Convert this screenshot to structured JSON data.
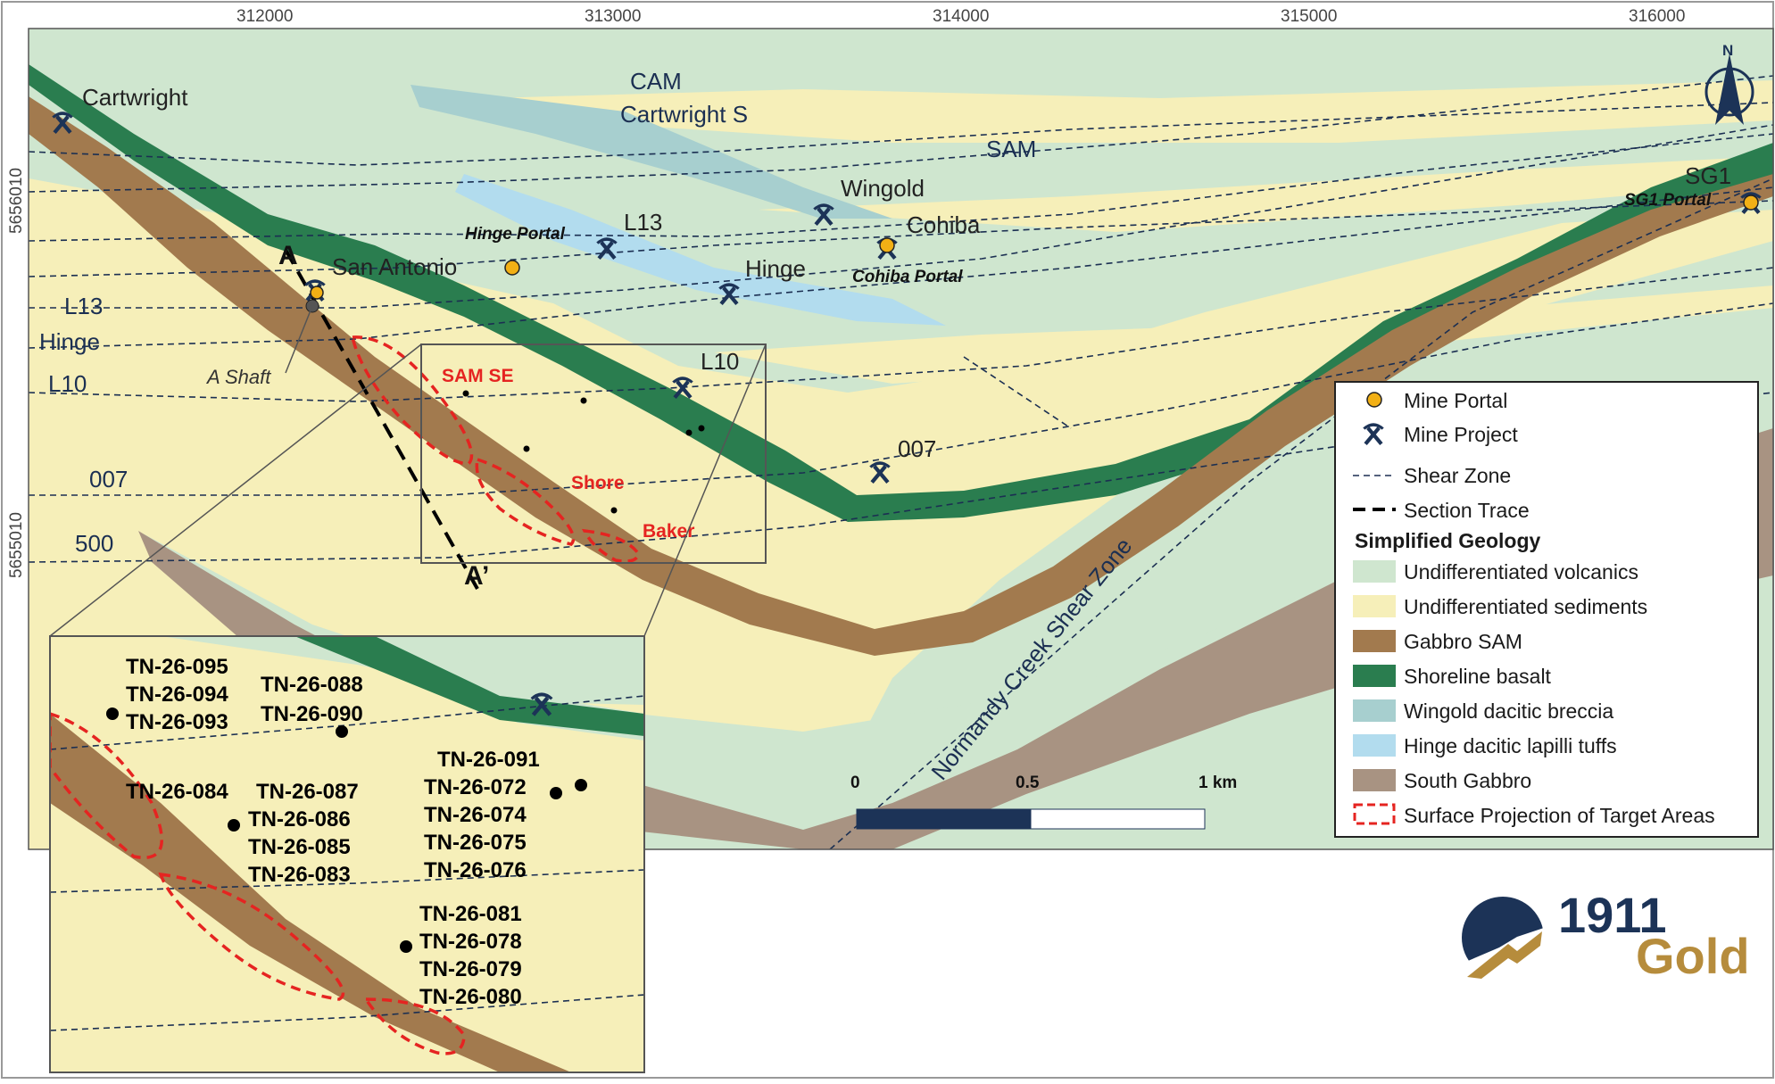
{
  "colors": {
    "sediments": "#f6efb9",
    "volcanics": "#cfe6cf",
    "gabbro_sam": "#a27a4e",
    "shoreline_basalt": "#2a7d4f",
    "wingold": "#a7cfcf",
    "hinge_tuffs": "#b2dcee",
    "south_gabbro": "#a89382",
    "target_outline": "#e52421",
    "shear": "#1b2f52",
    "portal": "#f2b015",
    "logo_navy": "#1c3357",
    "logo_gold": "#b68c3c"
  },
  "axes": {
    "eastings": [
      "312000",
      "313000",
      "314000",
      "315000",
      "316000"
    ],
    "northings": [
      "5656010",
      "5655010"
    ]
  },
  "north_arrow": "N",
  "shear_zones": [
    "CAM",
    "Cartwright S",
    "SAM",
    "L13",
    "Hinge",
    "L10",
    "007",
    "500",
    "Normandy Creek Shear Zone"
  ],
  "mines": {
    "cartwright": "Cartwright",
    "san_antonio": "San Antonio",
    "a_shaft": "A Shaft",
    "l13": "L13",
    "wingold": "Wingold",
    "cohiba": "Cohiba",
    "hinge": "Hinge",
    "l10": "L10",
    "m007": "007",
    "sg1": "SG1"
  },
  "portals": {
    "hinge": "Hinge Portal",
    "cohiba": "Cohiba Portal",
    "sg1": "SG1 Portal"
  },
  "section": {
    "start": "A",
    "end": "A’"
  },
  "targets": [
    "SAM SE",
    "Shore",
    "Baker"
  ],
  "inset_holes": {
    "g1": [
      "TN-26-095",
      "TN-26-094",
      "TN-26-093"
    ],
    "g2": [
      "TN-26-088",
      "TN-26-090"
    ],
    "g3": [
      "TN-26-091",
      "TN-26-072",
      "TN-26-074",
      "TN-26-075",
      "TN-26-076"
    ],
    "g4": [
      "TN-26-084"
    ],
    "g5": [
      "TN-26-087",
      "TN-26-086",
      "TN-26-085",
      "TN-26-083"
    ],
    "g6": [
      "TN-26-081",
      "TN-26-078",
      "TN-26-079",
      "TN-26-080"
    ]
  },
  "scale_bar": {
    "labels": [
      "0",
      "0.5",
      "1 km"
    ]
  },
  "legend": {
    "mine_portal": "Mine Portal",
    "mine_project": "Mine Project",
    "shear_zone": "Shear Zone",
    "section_trace": "Section Trace",
    "geology_heading": "Simplified Geology",
    "undiff_volcanics": "Undifferentiated volcanics",
    "undiff_sediments": "Undifferentiated sediments",
    "gabbro_sam": "Gabbro SAM",
    "shoreline_basalt": "Shoreline basalt",
    "wingold_breccia": "Wingold dacitic breccia",
    "hinge_tuffs": "Hinge dacitic lapilli tuffs",
    "south_gabbro": "South Gabbro",
    "target_areas": "Surface Projection of Target Areas"
  },
  "logo": {
    "number": "1911",
    "word": "Gold"
  }
}
